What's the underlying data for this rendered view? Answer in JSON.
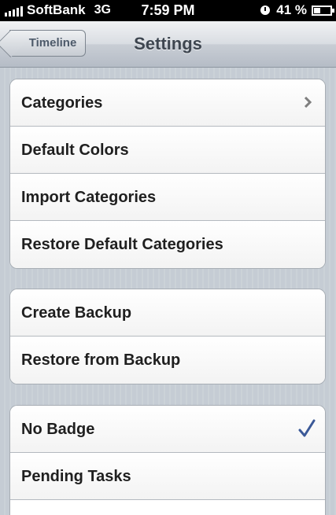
{
  "status_bar": {
    "carrier": "SoftBank",
    "network": "3G",
    "time": "7:59 PM",
    "battery_percent": "41 %",
    "battery_level": 0.41,
    "signal_bars": 5,
    "alarm_icon": "clock-icon"
  },
  "nav": {
    "back_label": "Timeline",
    "title": "Settings"
  },
  "groups": [
    {
      "rows": [
        {
          "label": "Categories",
          "accessory": "chevron"
        },
        {
          "label": "Default Colors",
          "accessory": "none"
        },
        {
          "label": "Import Categories",
          "accessory": "none"
        },
        {
          "label": "Restore Default Categories",
          "accessory": "none"
        }
      ]
    },
    {
      "rows": [
        {
          "label": "Create Backup",
          "accessory": "none"
        },
        {
          "label": "Restore from Backup",
          "accessory": "none"
        }
      ]
    },
    {
      "rows": [
        {
          "label": "No Badge",
          "accessory": "checkmark"
        },
        {
          "label": "Pending Tasks",
          "accessory": "none"
        }
      ]
    }
  ],
  "colors": {
    "background": "#c5ccd4",
    "checkmark": "#3b5998",
    "chevron": "#7f7f7f"
  }
}
